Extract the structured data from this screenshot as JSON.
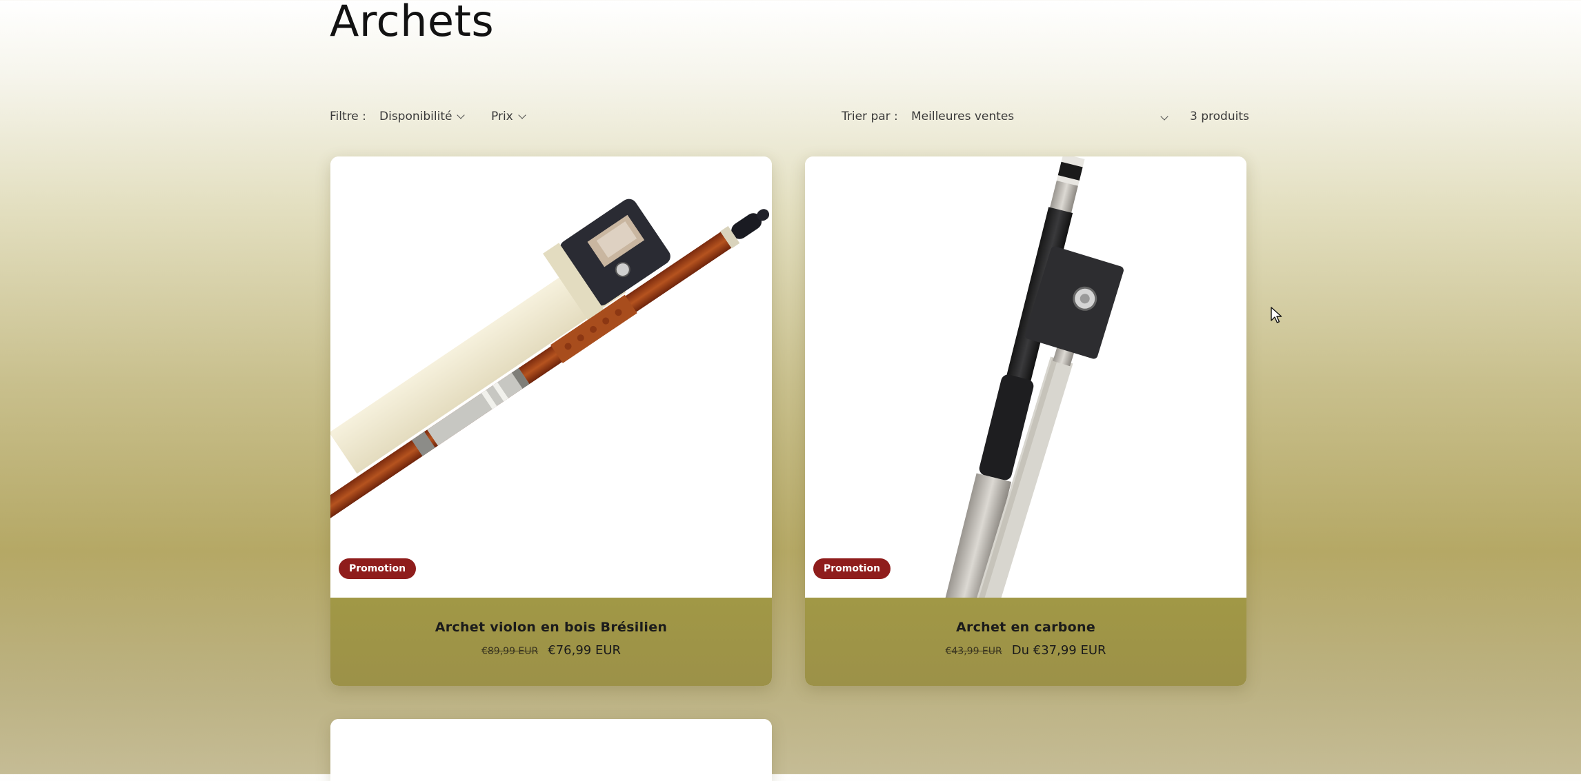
{
  "collection": {
    "title": "Archets"
  },
  "filters": {
    "filter_label": "Filtre :",
    "availability_label": "Disponibilité",
    "price_label": "Prix",
    "sort_label": "Trier par :",
    "sort_value": "Meilleures ventes",
    "product_count": "3 produits"
  },
  "products": [
    {
      "name": "Archet violon en bois Brésilien",
      "badge": "Promotion",
      "compare_price": "€89,99 EUR",
      "price": "€76,99 EUR"
    },
    {
      "name": "Archet en carbone",
      "badge": "Promotion",
      "compare_price": "€43,99 EUR",
      "price": "Du €37,99 EUR"
    },
    {
      "name": "",
      "badge": "",
      "compare_price": "",
      "price": ""
    }
  ],
  "colors": {
    "badge": "#8f1d1c",
    "card_info": "#9f9648",
    "title": "#121212"
  }
}
